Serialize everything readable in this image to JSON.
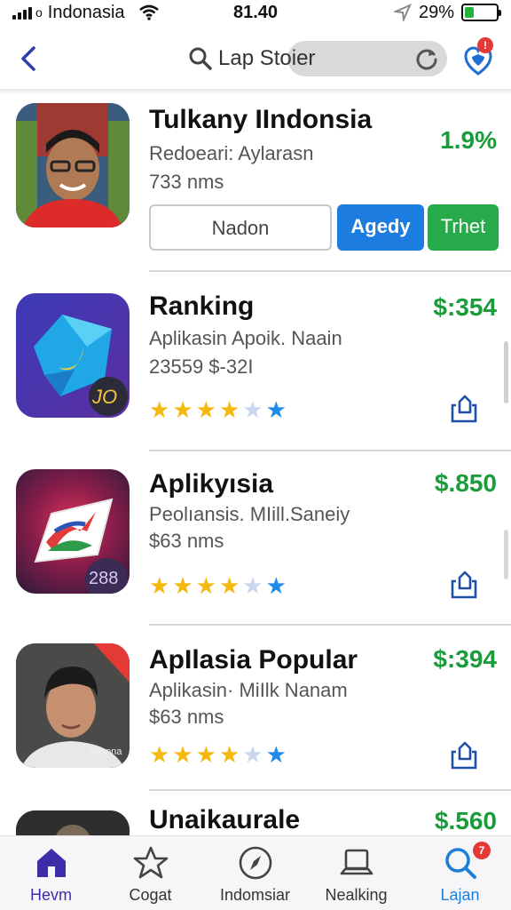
{
  "status_bar": {
    "carrier": "Indonasia",
    "time": "81.40",
    "battery_percent": "29%",
    "battery_level": 0.29,
    "battery_color": "#22b33a"
  },
  "nav": {
    "back_icon": "chevron-left-icon",
    "search_label": "Lap Stoier",
    "search_icon": "search-icon",
    "reload_icon": "reload-icon",
    "notification_icon": "heart-shield-icon",
    "notification_badge": "!"
  },
  "apps": [
    {
      "title": "Tulkany IIndonsia",
      "line1": "Redoeari: Aylarasn",
      "line2": "733 nms",
      "price": "1.9%",
      "buttons": [
        "Nadon",
        "Agedy",
        "Trhet"
      ]
    },
    {
      "title": "Ranking",
      "line1": "Aplikasin Apoik. Naain",
      "line2": "23559 $-32I",
      "price": "$:354",
      "badge": "JO",
      "rating": 4
    },
    {
      "title": "Aplikyısia",
      "line1": "Peolıansis. MIill.Saneiy",
      "line2": "$63 nms",
      "price": "$.850",
      "badge": "288",
      "rating": 4
    },
    {
      "title": "ApIlasia Popular",
      "line1": "Aplikasin· MiIlk Nanam",
      "line2": "$63 nms",
      "price": "$:394",
      "badge": "Aesona",
      "rating": 4
    },
    {
      "title": "Unaikaurale",
      "price": "$.560"
    }
  ],
  "tabs": [
    {
      "label": "Hevm",
      "icon": "home-icon"
    },
    {
      "label": "Cogat",
      "icon": "star-icon"
    },
    {
      "label": "Indomsiar",
      "icon": "compass-icon"
    },
    {
      "label": "Nealking",
      "icon": "laptop-icon"
    },
    {
      "label": "Lajan",
      "icon": "search-icon",
      "badge": "7"
    }
  ],
  "colors": {
    "accent_blue": "#1c7ce0",
    "accent_green": "#27ab4a",
    "price_green": "#1a9c3a",
    "nav_blue": "#2e3fa8",
    "star_gold": "#f5b80f"
  }
}
